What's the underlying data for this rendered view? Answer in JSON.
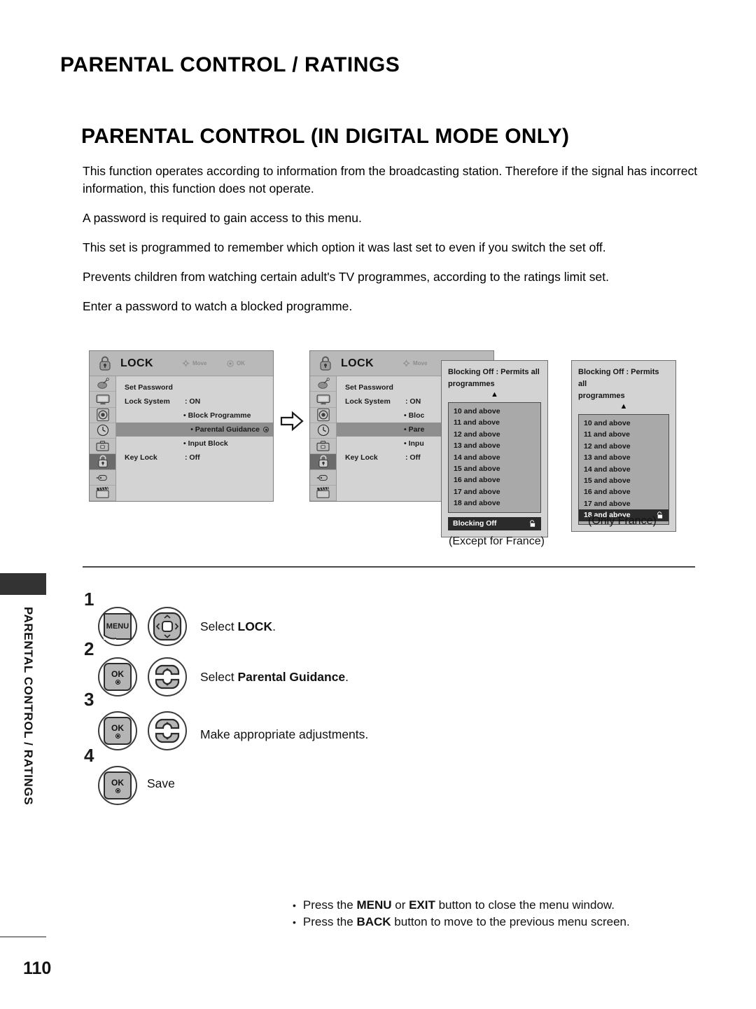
{
  "document": {
    "section_title": "PARENTAL CONTROL / RATINGS",
    "page_title": "PARENTAL CONTROL (IN DIGITAL MODE ONLY)",
    "page_number": "110",
    "side_tab_text": "PARENTAL CONTROL / RATINGS"
  },
  "paragraphs": [
    "This function operates according to information from the broadcasting station. Therefore if the signal has incorrect information, this function does not operate.",
    "A password is required to gain access to this menu.",
    "This set is programmed to remember which option it was last set to even if you switch the set off.",
    "Prevents children from watching certain adult's TV programmes, according to the ratings limit set.",
    "Enter a password to watch a blocked programme."
  ],
  "osd_menu": {
    "title": "LOCK",
    "hint_move": "Move",
    "hint_ok": "OK",
    "rows": [
      {
        "label": "Set Password",
        "value": ""
      },
      {
        "label": "Lock System",
        "value": ": ON"
      },
      {
        "label": "",
        "value": "• Block Programme"
      },
      {
        "label": "",
        "value": "• Parental Guidance"
      },
      {
        "label": "",
        "value": "• Input Block"
      },
      {
        "label": "Key Lock",
        "value": ": Off"
      }
    ],
    "highlighted_row_index": 3,
    "rail_icons": [
      "satellite-setup-icon",
      "picture-tv-icon",
      "audio-speaker-icon",
      "time-clock-icon",
      "option-toolbox-icon",
      "lock-padlock-icon",
      "input-plug-icon",
      "usb-movie-clapper-icon"
    ],
    "rail_active_index": 5,
    "truncated_rows": [
      {
        "label": "Set Password",
        "value": ""
      },
      {
        "label": "Lock System",
        "value": ": ON"
      },
      {
        "label": "",
        "value": "• Bloc"
      },
      {
        "label": "",
        "value": "• Pare"
      },
      {
        "label": "",
        "value": "• Inpu"
      },
      {
        "label": "Key Lock",
        "value": ": Off"
      }
    ]
  },
  "rating_panel": {
    "caption_line1": "Blocking Off : Permits all",
    "caption_line2": "programmes",
    "up_arrow": "▲",
    "items": [
      "10 and above",
      "11 and above",
      "12 and above",
      "13 and above",
      "14 and above",
      "15 and above",
      "16 and above",
      "17 and above",
      "18 and above"
    ],
    "lock_glyph": "⬚"
  },
  "panel_a": {
    "footer_label": "Blocking Off",
    "selected_item": null,
    "caption": "(Except for France)"
  },
  "panel_b": {
    "footer_label": null,
    "selected_item": "18 and above",
    "caption": "(Only France)"
  },
  "steps": [
    {
      "number": "1",
      "buttons": [
        "menu-button",
        "navigation-pad-button"
      ],
      "menu_label": "MENU",
      "text_prefix": "Select ",
      "text_bold": "LOCK",
      "text_suffix": "."
    },
    {
      "number": "2",
      "buttons": [
        "ok-button",
        "updown-wheel-button"
      ],
      "ok_label": "OK",
      "text_prefix": "Select ",
      "text_bold": "Parental Guidance",
      "text_suffix": "."
    },
    {
      "number": "3",
      "buttons": [
        "ok-button",
        "updown-wheel-button"
      ],
      "ok_label": "OK",
      "text_prefix": "Make appropriate adjustments.",
      "text_bold": "",
      "text_suffix": ""
    },
    {
      "number": "4",
      "buttons": [
        "ok-button"
      ],
      "ok_label": "OK",
      "text_prefix": "Save",
      "text_bold": "",
      "text_suffix": ""
    }
  ],
  "notes": [
    {
      "bullet": "•",
      "part1": "Press the ",
      "bold1": "MENU",
      "part2": " or ",
      "bold2": "EXIT",
      "part3": " button to close the menu window."
    },
    {
      "bullet": "•",
      "part1": "Press the ",
      "bold1": "BACK",
      "part2": " ",
      "bold2": "",
      "part3": " button to move to the previous menu screen."
    }
  ],
  "colors": {
    "osd_bg": "#d3d3d3",
    "osd_header": "#b9b9b9",
    "highlight": "#8f8f8f",
    "dark": "#2b2b2b",
    "rail": "#c0c0c0",
    "list_bg": "#a9a9a9"
  }
}
